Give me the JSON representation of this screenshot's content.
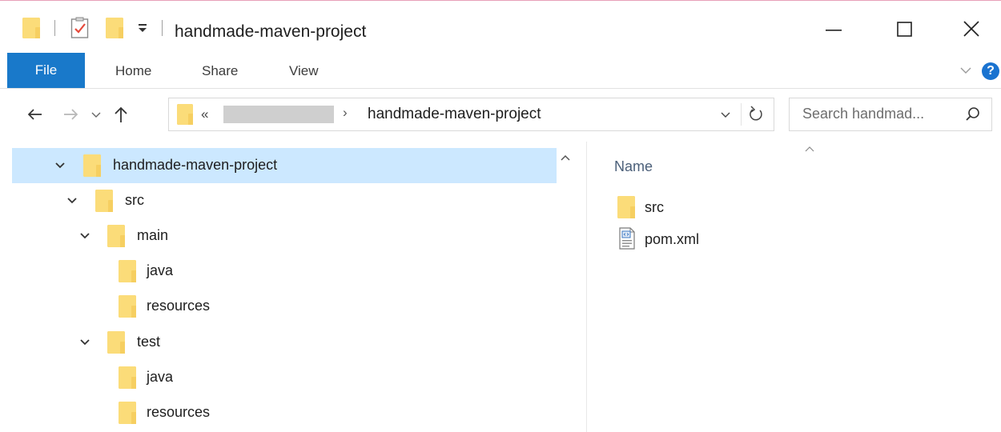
{
  "window": {
    "title": "handmade-maven-project",
    "controls": {
      "minimize": "minimize",
      "maximize": "maximize",
      "close": "close"
    }
  },
  "ribbon": {
    "tabs": [
      {
        "label": "File"
      },
      {
        "label": "Home"
      },
      {
        "label": "Share"
      },
      {
        "label": "View"
      }
    ],
    "help_label": "?"
  },
  "address_bar": {
    "overflow_chevrons": "«",
    "separator": "›",
    "current_folder": "handmade-maven-project"
  },
  "search": {
    "placeholder": "Search handmad..."
  },
  "navigation_tree": [
    {
      "label": "handmade-maven-project",
      "level": 0,
      "expanded": true,
      "selected": true
    },
    {
      "label": "src",
      "level": 1,
      "expanded": true
    },
    {
      "label": "main",
      "level": 2,
      "expanded": true
    },
    {
      "label": "java",
      "level": 3
    },
    {
      "label": "resources",
      "level": 3
    },
    {
      "label": "test",
      "level": 2,
      "expanded": true
    },
    {
      "label": "java",
      "level": 3
    },
    {
      "label": "resources",
      "level": 3
    }
  ],
  "content": {
    "column_header": "Name",
    "items": [
      {
        "name": "src",
        "icon": "folder-icon"
      },
      {
        "name": "pom.xml",
        "icon": "xml-file-icon"
      }
    ]
  },
  "colors": {
    "accent": "#1979ca",
    "selection": "#cce8ff",
    "folder": "#f0c453"
  }
}
